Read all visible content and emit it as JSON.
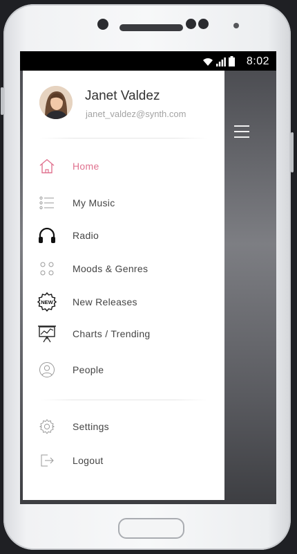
{
  "status_bar": {
    "time": "8:02"
  },
  "user": {
    "name": "Janet Valdez",
    "email": "janet_valdez@synth.com"
  },
  "menu": {
    "items": [
      {
        "label": "Home",
        "icon": "home-icon",
        "active": true
      },
      {
        "label": "My Music",
        "icon": "list-icon"
      },
      {
        "label": "Radio",
        "icon": "headphones-icon"
      },
      {
        "label": "Moods & Genres",
        "icon": "four-dots-icon"
      },
      {
        "label": "New Releases",
        "icon": "new-badge-icon"
      },
      {
        "label": "Charts / Trending",
        "icon": "chart-board-icon"
      },
      {
        "label": "People",
        "icon": "person-icon"
      }
    ],
    "footer": [
      {
        "label": "Settings",
        "icon": "gear-icon"
      },
      {
        "label": "Logout",
        "icon": "logout-icon"
      }
    ]
  },
  "colors": {
    "accent": "#e0728f",
    "text": "#444444",
    "muted": "#a3a3a3"
  }
}
